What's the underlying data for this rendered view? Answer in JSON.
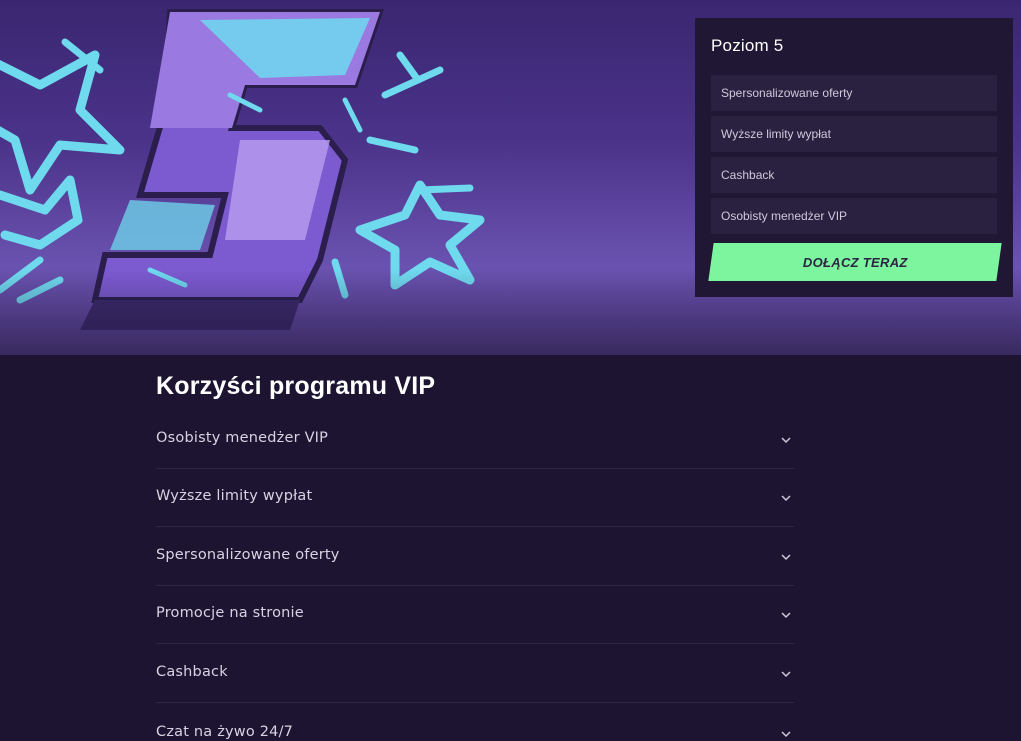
{
  "level_card": {
    "title": "Poziom 5",
    "benefits": [
      "Spersonalizowane oferty",
      "Wyższe limity wypłat",
      "Cashback",
      "Osobisty menedżer VIP"
    ],
    "join_label": "DOŁĄCZ TERAZ",
    "join_color": "#7cf59e"
  },
  "vip": {
    "title": "Korzyści programu VIP",
    "items": [
      {
        "label": "Osobisty menedżer VIP",
        "icon": "chevron-down-icon"
      },
      {
        "label": "Wyższe limity wypłat",
        "icon": "chevron-down-icon"
      },
      {
        "label": "Spersonalizowane oferty",
        "icon": "chevron-down-icon"
      },
      {
        "label": "Promocje na stronie",
        "icon": "chevron-down-icon"
      },
      {
        "label": "Cashback",
        "icon": "chevron-down-icon"
      },
      {
        "label": "Czat na żywo 24/7",
        "icon": "chevron-down-icon"
      }
    ]
  },
  "colors": {
    "background": "#1c1430",
    "hero_purple": "#4b338a",
    "accent_cyan": "#6fd9ee",
    "accent_green": "#7cf59e"
  },
  "hero": {
    "icon": "level-5-badge-icon"
  }
}
